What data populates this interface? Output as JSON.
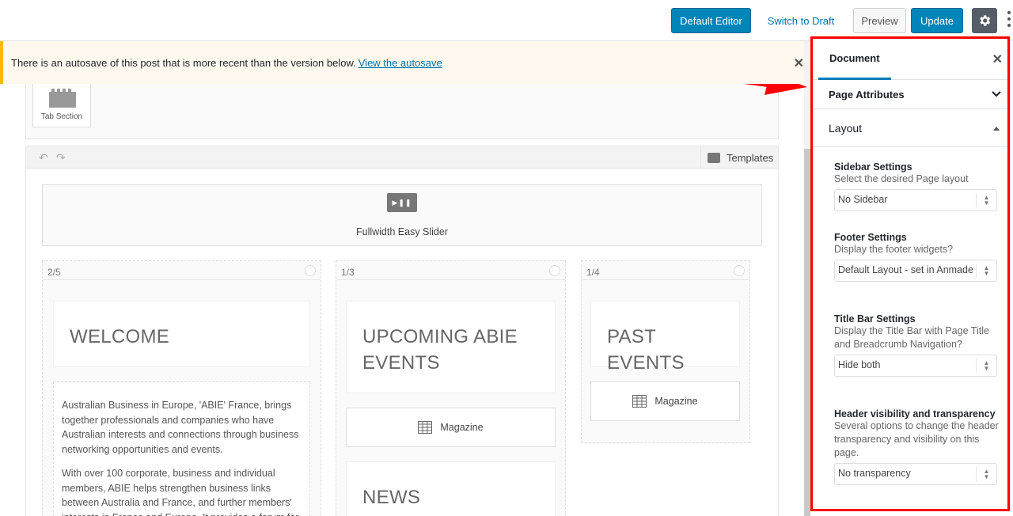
{
  "topbar": {
    "default_editor": "Default Editor",
    "switch_to_draft": "Switch to Draft",
    "preview": "Preview",
    "update": "Update"
  },
  "notice": {
    "text": "There is an autosave of this post that is more recent than the version below.",
    "link": "View the autosave"
  },
  "builder": {
    "tab_section": "Tab Section",
    "templates": "Templates",
    "slider_label": "Fullwidth Easy Slider",
    "columns": [
      {
        "size": "2/5",
        "heading": "WELCOME",
        "paragraphs": [
          "Australian Business in Europe, 'ABIE' France, brings together professionals and companies who have Australian interests and connections through business networking opportunities and events.",
          "With over 100 corporate, business and individual members, ABIE helps strengthen business links between Australia and France, and further members' interests in France and Europe. It provides a forum for"
        ]
      },
      {
        "size": "1/3",
        "heading": "UPCOMING ABIE EVENTS",
        "module": "Magazine",
        "heading2": "NEWS"
      },
      {
        "size": "1/4",
        "heading": "PAST EVENTS",
        "module": "Magazine"
      }
    ]
  },
  "sidebar": {
    "tab": "Document",
    "page_attributes": "Page Attributes",
    "layout": "Layout",
    "fields": [
      {
        "label": "Sidebar Settings",
        "help": "Select the desired Page layout",
        "value": "No Sidebar"
      },
      {
        "label": "Footer Settings",
        "help": "Display the footer widgets?",
        "value": "Default Layout - set in Anmade"
      },
      {
        "label": "Title Bar Settings",
        "help": "Display the Title Bar with Page Title and Breadcrumb Navigation?",
        "value": "Hide both"
      },
      {
        "label": "Header visibility and transparency",
        "help": "Several options to change the header transparency and visibility on this page.",
        "value": "No transparency"
      }
    ]
  },
  "colors": {
    "primary": "#0085ba",
    "highlight": "#ff0000",
    "notice_border": "#ffb900"
  }
}
